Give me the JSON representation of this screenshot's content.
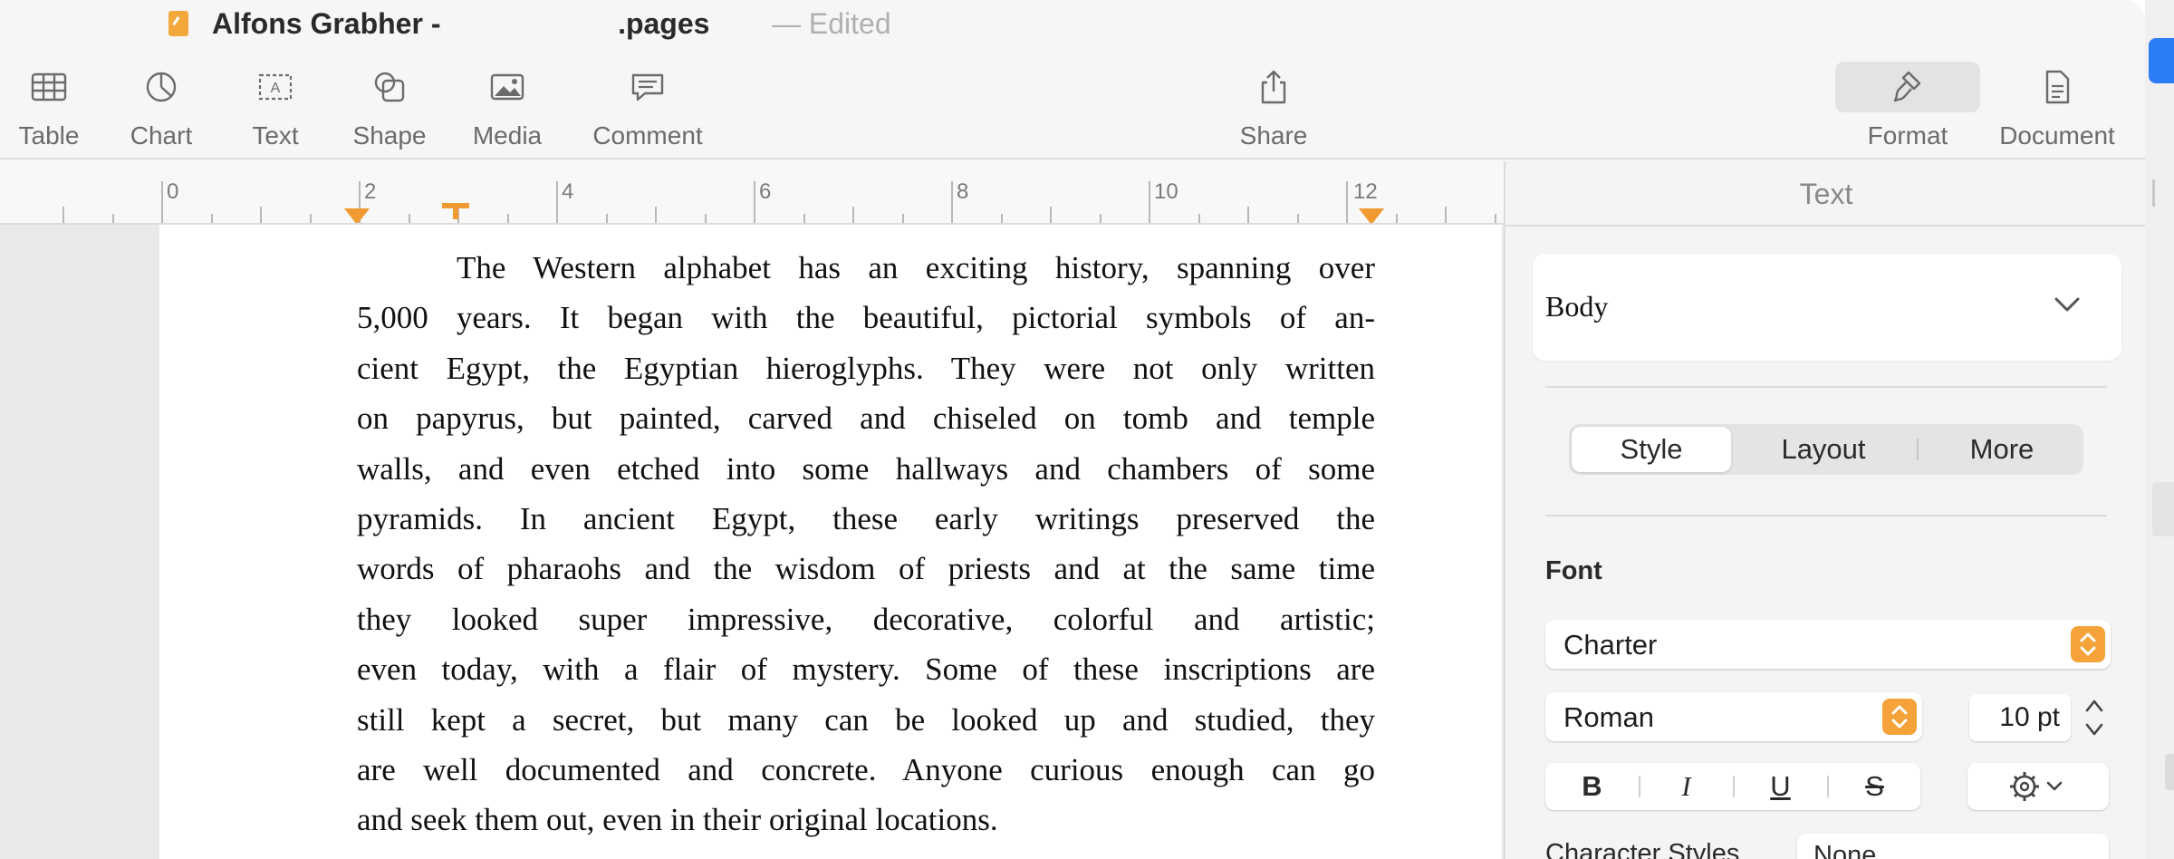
{
  "window": {
    "title": "Alfons Grabher -                      .pages",
    "separator": "—",
    "status": "Edited"
  },
  "toolbar": {
    "table": "Table",
    "chart": "Chart",
    "text": "Text",
    "shape": "Shape",
    "media": "Media",
    "comment": "Comment",
    "share": "Share",
    "format": "Format",
    "document": "Document"
  },
  "ruler": {
    "labels": [
      "0",
      "2",
      "4",
      "6",
      "8",
      "10",
      "12"
    ],
    "marker_color": "#f09a31"
  },
  "document": {
    "lines": [
      "The Western alphabet has an exciting history, spanning over",
      "5,000 years. It began with the beautiful, pictorial symbols of an-",
      "cient Egypt, the Egyptian hieroglyphs. They were not only written",
      "on papyrus, but painted, carved and chiseled on tomb and temple",
      "walls, and even etched into some hallways and chambers of some",
      "pyramids. In ancient Egypt, these early writings preserved the",
      "words of pharaohs and the wisdom of priests and at the same time",
      "they looked super impressive, decorative, colorful and artistic;",
      "even today, with a flair of mystery. Some of these inscriptions are",
      "still kept a secret, but many can be looked up and studied, they",
      "are well documented and concrete. Anyone curious enough can go",
      "and seek them out, even in their original locations."
    ]
  },
  "sidebar": {
    "title": "Text",
    "paragraph_style": "Body",
    "tabs": [
      "Style",
      "Layout",
      "More"
    ],
    "active_tab": "Style",
    "font_heading": "Font",
    "font_family": "Charter",
    "font_typeface": "Roman",
    "font_size": "10 pt",
    "bius": [
      "B",
      "I",
      "U",
      "S"
    ],
    "character_styles_label": "Character Styles",
    "character_styles_value": "None",
    "accent_color": "#f6a23a"
  }
}
